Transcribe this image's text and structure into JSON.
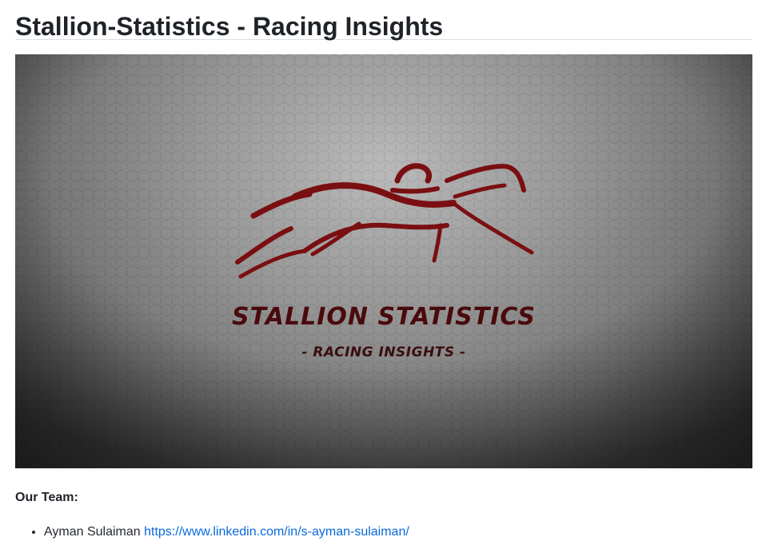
{
  "page": {
    "title": "Stallion-Statistics - Racing Insights"
  },
  "banner": {
    "logo_name": "STALLION STATISTICS",
    "logo_tagline": "- RACING INSIGHTS -",
    "icon": "horse-jockey-icon",
    "colors": {
      "logo": "#7a0f12",
      "background_light": "#b4b4b4",
      "background_dark": "#3a3a3a"
    }
  },
  "team": {
    "heading": "Our Team:",
    "members": [
      {
        "name": "Ayman Sulaiman",
        "url": "https://www.linkedin.com/in/s-ayman-sulaiman/"
      }
    ]
  }
}
